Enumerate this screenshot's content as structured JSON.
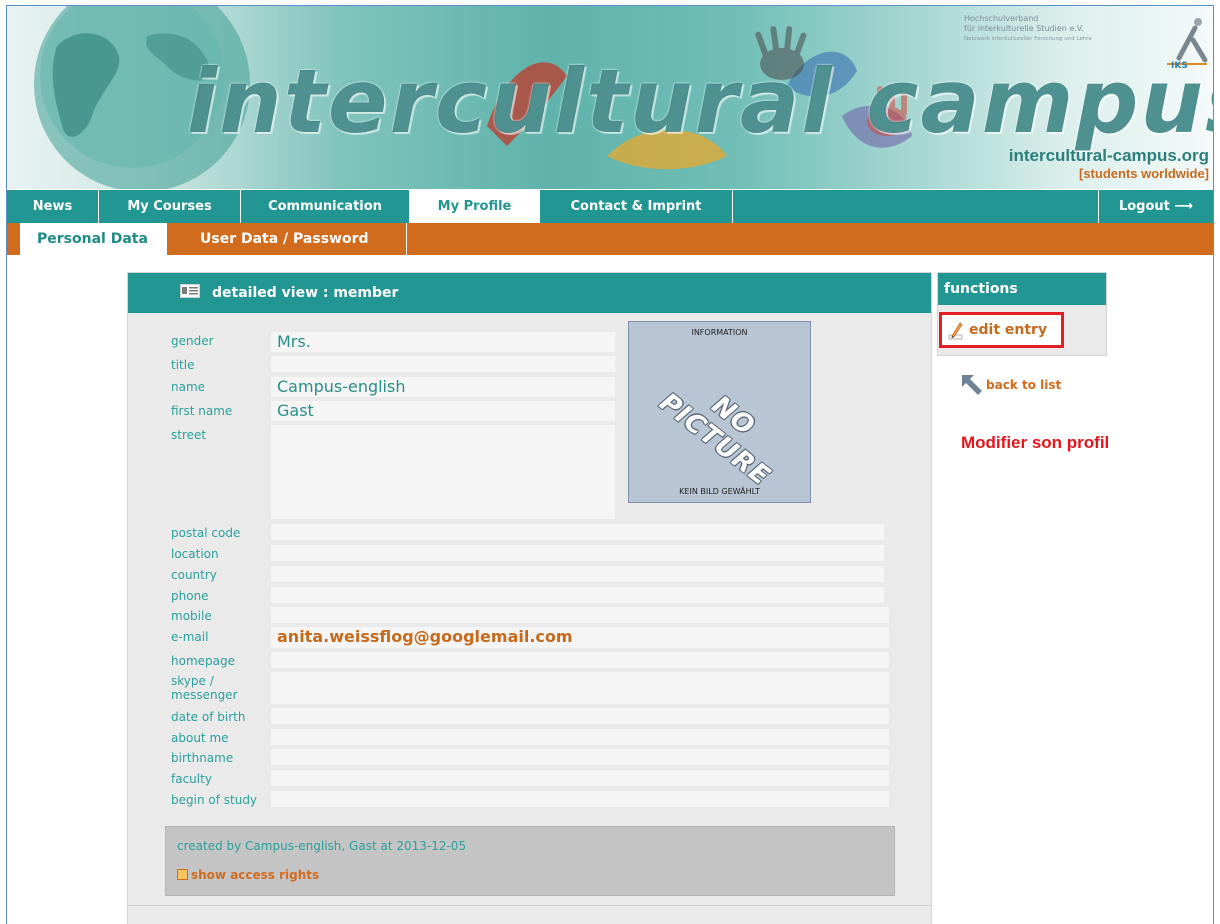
{
  "banner": {
    "title": "intercultural campus",
    "association_line1": "Hochschulverband",
    "association_line2": "für interkulturelle Studien e.V.",
    "association_line3": "Netzwerk interkultureller Forschung und Lehre",
    "logo_text": "IKS",
    "site_url": "intercultural-campus.org",
    "site_tagline": "[students worldwide]"
  },
  "nav": {
    "items": [
      {
        "label": "News"
      },
      {
        "label": "My Courses"
      },
      {
        "label": "Communication"
      },
      {
        "label": "My Profile"
      },
      {
        "label": "Contact & Imprint"
      }
    ],
    "active": "My Profile",
    "logout": "Logout ⟶"
  },
  "subnav": {
    "items": [
      {
        "label": "Personal Data"
      },
      {
        "label": "User Data / Password"
      }
    ],
    "active": "Personal Data"
  },
  "panel": {
    "title": "detailed view : member",
    "fields": {
      "gender": {
        "label": "gender",
        "value": "Mrs."
      },
      "title": {
        "label": "title",
        "value": ""
      },
      "name": {
        "label": "name",
        "value": "Campus-english"
      },
      "first_name": {
        "label": "first name",
        "value": "Gast"
      },
      "street": {
        "label": "street",
        "value": ""
      },
      "postal_code": {
        "label": "postal code",
        "value": ""
      },
      "location": {
        "label": "location",
        "value": ""
      },
      "country": {
        "label": "country",
        "value": ""
      },
      "phone": {
        "label": "phone",
        "value": ""
      },
      "mobile": {
        "label": "mobile",
        "value": ""
      },
      "email": {
        "label": "e-mail",
        "value": "anita.weissflog@googlemail.com"
      },
      "homepage": {
        "label": "homepage",
        "value": ""
      },
      "skype_line1": {
        "label": "skype /"
      },
      "skype_line2": {
        "label": "messenger",
        "value": ""
      },
      "date_of_birth": {
        "label": "date of birth",
        "value": ""
      },
      "about_me": {
        "label": "about me",
        "value": ""
      },
      "birthname": {
        "label": "birthname",
        "value": ""
      },
      "faculty": {
        "label": "faculty",
        "value": ""
      },
      "begin_of_study": {
        "label": "begin of study",
        "value": ""
      }
    },
    "picture": {
      "top": "INFORMATION",
      "main": "NO PICTURE",
      "bottom": "KEIN BILD GEWÄHLT"
    },
    "created": "created by Campus-english, Gast at 2013-12-05",
    "access_rights": "show access rights"
  },
  "functions": {
    "title": "functions",
    "edit_entry": "edit entry",
    "back_to_list": "back to list"
  },
  "annotation": "Modifier son profil",
  "colors": {
    "teal": "#229693",
    "orange": "#d16c1f",
    "highlight_red": "#e31e24"
  }
}
